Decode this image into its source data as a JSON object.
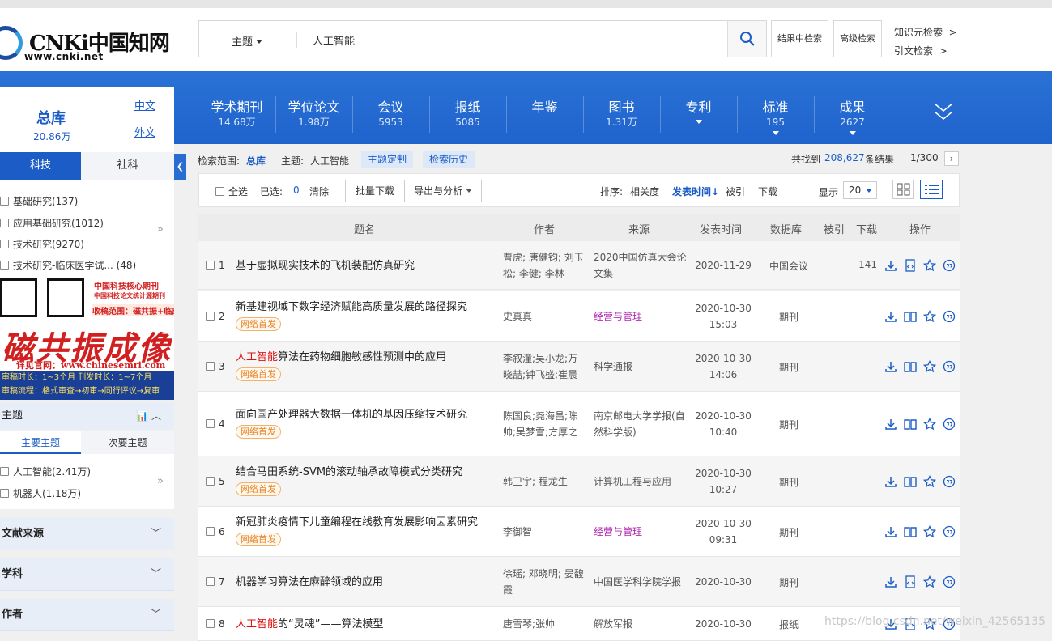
{
  "logo": {
    "brand": "CNKi中国知网",
    "url": "www.cnki.net"
  },
  "search": {
    "field": "主题",
    "query": "人工智能"
  },
  "header_buttons": {
    "within": "结果中检索",
    "advanced": "高级检索"
  },
  "header_links": [
    "知识元检索",
    "引文检索"
  ],
  "zongku": {
    "title": "总库",
    "count": "20.86万",
    "cn": "中文",
    "en": "外文"
  },
  "categories": [
    {
      "label": "学术期刊",
      "count": "14.68万",
      "dropdown": false
    },
    {
      "label": "学位论文",
      "count": "1.98万",
      "dropdown": false
    },
    {
      "label": "会议",
      "count": "5953",
      "dropdown": false
    },
    {
      "label": "报纸",
      "count": "5085",
      "dropdown": false
    },
    {
      "label": "年鉴",
      "count": "",
      "dropdown": false
    },
    {
      "label": "图书",
      "count": "1.31万",
      "dropdown": false
    },
    {
      "label": "专利",
      "count": "",
      "dropdown": true
    },
    {
      "label": "标准",
      "count": "195",
      "dropdown": true
    },
    {
      "label": "成果",
      "count": "2627",
      "dropdown": true
    }
  ],
  "sidebar": {
    "tabs": [
      "科技",
      "社科"
    ],
    "subjects": [
      "基础研究(137)",
      "应用基础研究(1012)",
      "技术研究(9270)",
      "技术研究-临床医学试... (48)"
    ],
    "ad": {
      "line1": "中国科技核心期刊",
      "line2": "中国科技论文统计源期刊",
      "banner": "收稿范围：磁共振+临床",
      "big": "磁共振成像",
      "site": "详见官网：www.chinesemri.com",
      "strip1": "审稿时长：1~3个月   刊发时长：1~7个月",
      "strip2": "审稿流程：格式审查→初审→同行评议→复审"
    },
    "theme_head": "主题",
    "theme_tabs": [
      "主要主题",
      "次要主题"
    ],
    "theme_items": [
      "人工智能(2.41万)",
      "机器人(1.18万)"
    ],
    "collapsed": [
      "文献来源",
      "学科",
      "作者"
    ]
  },
  "scope": {
    "label": "检索范围:",
    "value": "总库",
    "theme_label": "主题:",
    "theme_value": "人工智能",
    "btn_custom": "主题定制",
    "btn_history": "检索历史",
    "found_prefix": "共找到",
    "found_count": "208,627",
    "found_suffix": "条结果",
    "page": "1/300"
  },
  "toolbar": {
    "select_all": "全选",
    "selected_label": "已选:",
    "selected_count": "0",
    "clear": "清除",
    "batch_download": "批量下载",
    "export": "导出与分析",
    "sort_label": "排序:",
    "sort_options": [
      "相关度",
      "发表时间",
      "被引",
      "下载"
    ],
    "show_label": "显示",
    "page_size": "20"
  },
  "table": {
    "headers": [
      "题名",
      "作者",
      "来源",
      "发表时间",
      "数据库",
      "被引",
      "下载",
      "操作"
    ],
    "rows": [
      {
        "num": "1",
        "pre": "",
        "hl": "",
        "title": "基于虚拟现实技术的飞机装配仿真研究",
        "badge": "",
        "authors": "曹虎; 唐健钧; 刘玉松; 李健; 李林",
        "source": "2020中国仿真大会论文集",
        "date": "2020-11-29",
        "time": "",
        "db": "中国会议",
        "cited": "",
        "downloads": "141"
      },
      {
        "num": "2",
        "pre": "",
        "hl": "",
        "title": "新基建视域下数字经济赋能高质量发展的路径探究",
        "badge": "网络首发",
        "authors": "史真真",
        "source": "经营与管理",
        "date": "2020-10-30",
        "time": "15:03",
        "db": "期刊",
        "cited": "",
        "downloads": ""
      },
      {
        "num": "3",
        "pre": "",
        "hl": "人工智能",
        "title": "算法在药物细胞敏感性预测中的应用",
        "badge": "网络首发",
        "authors": "李叙潼;吴小龙;万晓喆;钟飞盛;崔晨",
        "source": "科学通报",
        "date": "2020-10-30",
        "time": "14:06",
        "db": "期刊",
        "cited": "",
        "downloads": ""
      },
      {
        "num": "4",
        "pre": "",
        "hl": "",
        "title": "面向国产处理器大数据一体机的基因压缩技术研究",
        "badge": "网络首发",
        "authors": "陈国良;尧海昌;陈帅;吴梦雪;方厚之",
        "source": "南京邮电大学学报(自然科学版)",
        "date": "2020-10-30",
        "time": "10:40",
        "db": "期刊",
        "cited": "",
        "downloads": ""
      },
      {
        "num": "5",
        "pre": "",
        "hl": "",
        "title": "结合马田系统-SVM的滚动轴承故障模式分类研究",
        "badge": "网络首发",
        "authors": "韩卫宇; 程龙生",
        "source": "计算机工程与应用",
        "date": "2020-10-30",
        "time": "10:27",
        "db": "期刊",
        "cited": "",
        "downloads": ""
      },
      {
        "num": "6",
        "pre": "",
        "hl": "",
        "title": "新冠肺炎疫情下儿童编程在线教育发展影响因素研究",
        "badge": "网络首发",
        "authors": "李御智",
        "source": "经营与管理",
        "date": "2020-10-30",
        "time": "09:31",
        "db": "期刊",
        "cited": "",
        "downloads": ""
      },
      {
        "num": "7",
        "pre": "",
        "hl": "",
        "title": "机器学习算法在麻醉领域的应用",
        "badge": "",
        "authors": "徐瑶; 邓晓明; 晏馥霞",
        "source": "中国医学科学院学报",
        "date": "2020-10-30",
        "time": "",
        "db": "期刊",
        "cited": "",
        "downloads": ""
      },
      {
        "num": "8",
        "pre": "",
        "hl": "人工智能",
        "title": "的“灵魂”——算法模型",
        "badge": "",
        "authors": "唐雪琴;张帅",
        "source": "解放军报",
        "date": "2020-10-30",
        "time": "",
        "db": "报纸",
        "cited": "",
        "downloads": ""
      }
    ]
  },
  "watermark": "https://blog.csdn.net/weixin_42565135",
  "colors": {
    "brand_blue": "#1f63cc",
    "highlight_red": "#dd1111",
    "badge_orange": "#e6862a",
    "magenta_source": "#b02ab0"
  }
}
